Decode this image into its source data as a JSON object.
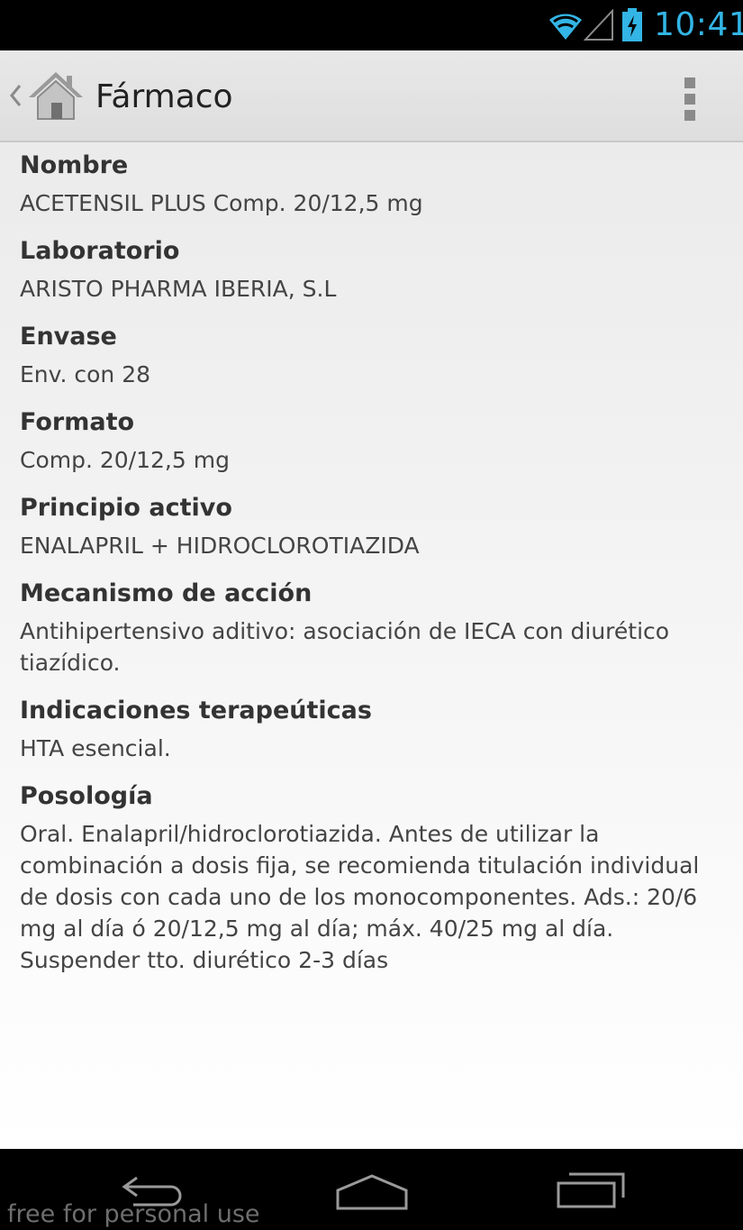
{
  "status_bar": {
    "time": "10:41",
    "icons": [
      "wifi-icon",
      "signal-icon",
      "battery-charging-icon"
    ],
    "accent_color": "#33b5e5"
  },
  "action_bar": {
    "title": "Fármaco",
    "icons": [
      "up-chevron-icon",
      "home-icon",
      "overflow-menu-icon"
    ]
  },
  "fields": [
    {
      "label": "Nombre",
      "value": "ACETENSIL PLUS Comp. 20/12,5 mg"
    },
    {
      "label": "Laboratorio",
      "value": "ARISTO PHARMA IBERIA, S.L"
    },
    {
      "label": "Envase",
      "value": "Env. con 28"
    },
    {
      "label": "Formato",
      "value": "Comp. 20/12,5 mg"
    },
    {
      "label": "Principio activo",
      "value": "ENALAPRIL + HIDROCLOROTIAZIDA"
    },
    {
      "label": "Mecanismo de acción",
      "value": "Antihipertensivo aditivo: asociación de IECA con diurético tiazídico."
    },
    {
      "label": "Indicaciones terapeúticas",
      "value": "HTA esencial."
    },
    {
      "label": "Posología",
      "value": "Oral. Enalapril/hidroclorotiazida. Antes de utilizar la combinación a dosis fija, se recomienda titulación individual de dosis con cada uno de los monocomponentes. Ads.: 20/6 mg al día ó 20/12,5 mg al día; máx. 40/25 mg al día. Suspender tto. diurético 2-3 días"
    }
  ],
  "nav_bar": {
    "icons": [
      "back-icon",
      "home-nav-icon",
      "recents-icon"
    ]
  },
  "watermark": "free for personal use"
}
